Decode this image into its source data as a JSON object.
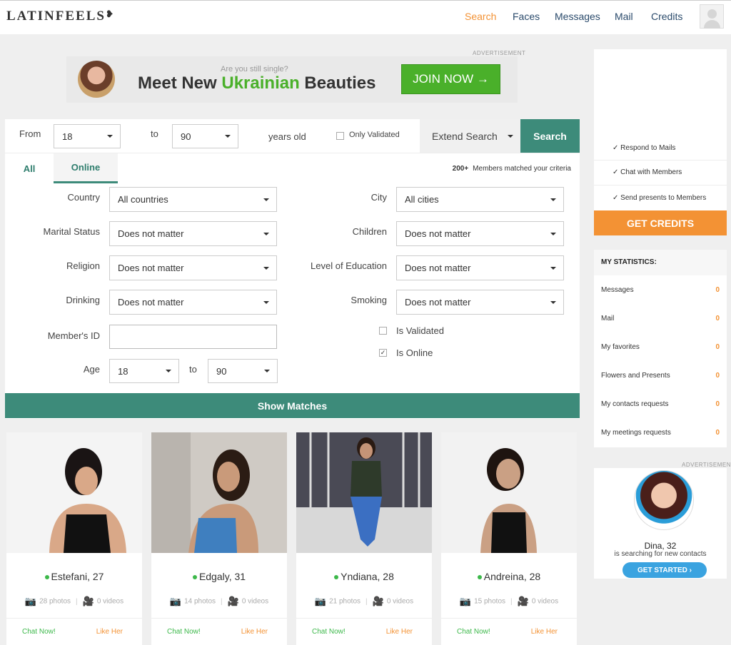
{
  "header": {
    "logo": "LATINFEELS",
    "logo_mark": "❥",
    "nav": [
      "Search",
      "Faces",
      "Messages",
      "Mail",
      "Credits"
    ]
  },
  "ad_label": "ADVERTISEMENT",
  "banner": {
    "question": "Are you still single?",
    "headline_pre": "Meet New ",
    "headline_hl": "Ukrainian",
    "headline_post": " Beauties",
    "join": "JOIN NOW →"
  },
  "search": {
    "from_label": "From",
    "from_value": "18",
    "to_label": "to",
    "to_value": "90",
    "years_old": "years old",
    "only_validated": "Only Validated",
    "extend": "Extend Search",
    "search_btn": "Search",
    "tab_all": "All",
    "tab_online": "Online",
    "matched_count": "200+",
    "matched_text": "Members matched your criteria",
    "country_label": "Country",
    "country_value": "All countries",
    "city_label": "City",
    "city_value": "All cities",
    "marital_label": "Marital Status",
    "marital_value": "Does not matter",
    "children_label": "Children",
    "children_value": "Does not matter",
    "religion_label": "Religion",
    "religion_value": "Does not matter",
    "education_label": "Level of Education",
    "education_value": "Does not matter",
    "drinking_label": "Drinking",
    "drinking_value": "Does not matter",
    "smoking_label": "Smoking",
    "smoking_value": "Does not matter",
    "member_id_label": "Member's ID",
    "member_id_value": "",
    "is_validated": "Is Validated",
    "is_online": "Is Online",
    "age_label": "Age",
    "age_from": "18",
    "age_to_label": "to",
    "age_to": "90",
    "show_matches": "Show Matches"
  },
  "profiles": [
    {
      "name": "Estefani, 27",
      "photos": "28 photos",
      "videos": "0 videos",
      "chat": "Chat Now!",
      "like": "Like Her"
    },
    {
      "name": "Edgaly, 31",
      "photos": "14 photos",
      "videos": "0 videos",
      "chat": "Chat Now!",
      "like": "Like Her"
    },
    {
      "name": "Yndiana, 28",
      "photos": "21 photos",
      "videos": "0 videos",
      "chat": "Chat Now!",
      "like": "Like Her"
    },
    {
      "name": "Andreina, 28",
      "photos": "15 photos",
      "videos": "0 videos",
      "chat": "Chat Now!",
      "like": "Like Her"
    }
  ],
  "credits_box": {
    "items": [
      "✓ Respond to Mails",
      "✓ Chat with Members",
      "✓ Send presents to Members"
    ],
    "button": "GET CREDITS"
  },
  "stats": {
    "title": "MY STATISTICS:",
    "rows": [
      {
        "label": "Messages",
        "value": "0"
      },
      {
        "label": "Mail",
        "value": "0"
      },
      {
        "label": "My favorites",
        "value": "0"
      },
      {
        "label": "Flowers and Presents",
        "value": "0"
      },
      {
        "label": "My contacts requests",
        "value": "0"
      },
      {
        "label": "My meetings requests",
        "value": "0"
      }
    ]
  },
  "side_ad": {
    "name": "Dina, 32",
    "sub": "is searching for new contacts",
    "button": "GET STARTED ›"
  },
  "colors": {
    "accent": "#f39234",
    "teal": "#3d8b7a",
    "green": "#4ab02a",
    "blue": "#3aa3e0"
  }
}
